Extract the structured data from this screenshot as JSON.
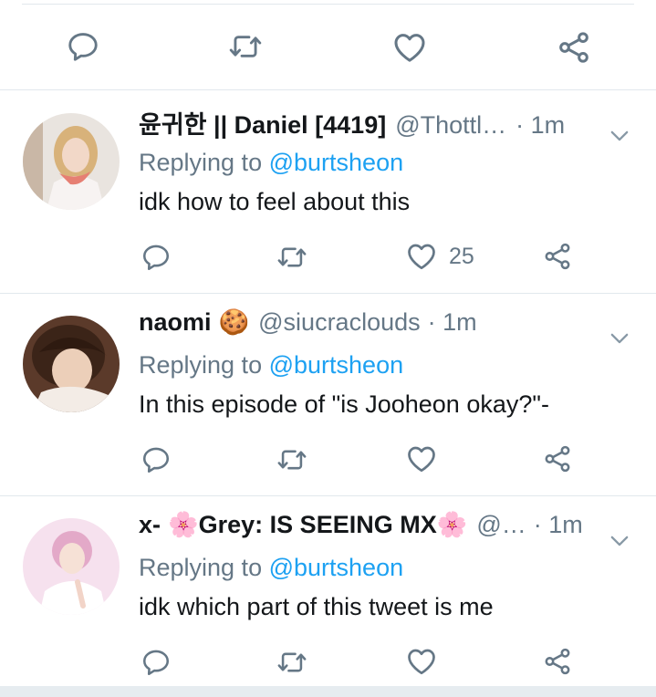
{
  "top_actions": {
    "icons": [
      "reply-icon",
      "retweet-icon",
      "like-icon",
      "share-icon"
    ]
  },
  "tweets": [
    {
      "name": "윤귀한 || Daniel [4419]",
      "handle": "@Thottl…",
      "time": "· 1m",
      "reply_prefix": "Replying to",
      "reply_to": "@burtsheon",
      "text": "idk how to feel about this",
      "like_count": "25"
    },
    {
      "name": "naomi",
      "name_emoji": "🍪",
      "handle": "@siucraclouds",
      "time": "· 1m",
      "reply_prefix": "Replying to",
      "reply_to": "@burtsheon",
      "text": "In this episode of \"is Jooheon okay?\"-",
      "like_count": ""
    },
    {
      "name_prefix": "x-",
      "name_flower": "🌸",
      "name": "Grey: IS SEEING MX",
      "handle": "@…",
      "time": "· 1m",
      "reply_prefix": "Replying to",
      "reply_to": "@burtsheon",
      "text": "idk which part of this tweet is me",
      "like_count": ""
    }
  ],
  "colors": {
    "accent": "#1da1f2",
    "muted": "#657786",
    "text": "#14171a",
    "divider": "#e1e8ed"
  }
}
